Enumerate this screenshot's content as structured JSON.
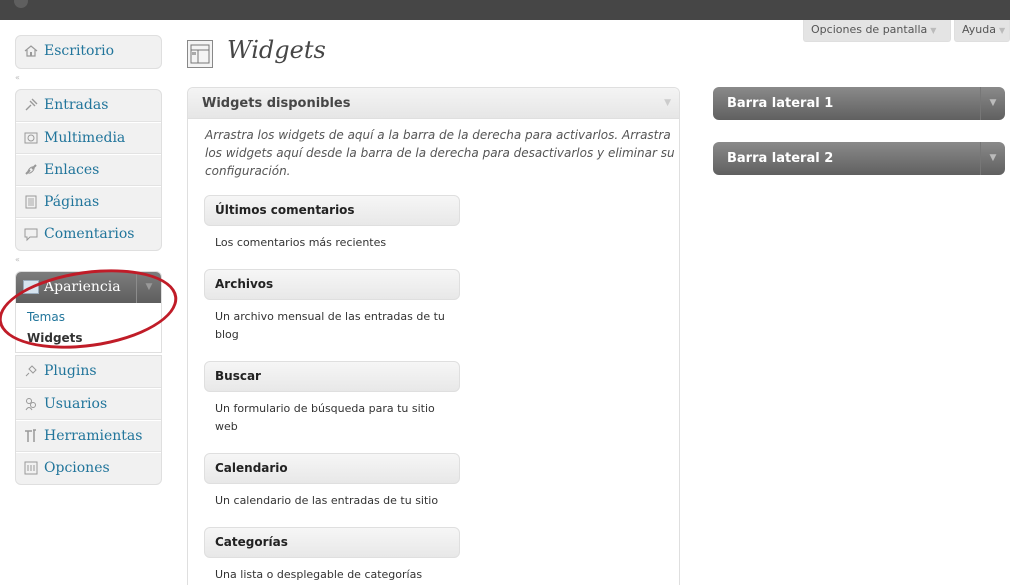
{
  "header": {
    "screen_options_label": "Opciones de pantalla",
    "help_label": "Ayuda"
  },
  "sidebar": {
    "items_top": [
      {
        "label": "Escritorio",
        "icon": "home-icon"
      }
    ],
    "items_content": [
      {
        "label": "Entradas",
        "icon": "pin-icon"
      },
      {
        "label": "Multimedia",
        "icon": "media-icon"
      },
      {
        "label": "Enlaces",
        "icon": "link-icon"
      },
      {
        "label": "Páginas",
        "icon": "page-icon"
      },
      {
        "label": "Comentarios",
        "icon": "comment-icon"
      }
    ],
    "appearance": {
      "label": "Apariencia",
      "icon": "appearance-icon",
      "submenu": [
        "Temas",
        "Widgets"
      ]
    },
    "items_bottom": [
      {
        "label": "Plugins",
        "icon": "plugin-icon"
      },
      {
        "label": "Usuarios",
        "icon": "users-icon"
      },
      {
        "label": "Herramientas",
        "icon": "tools-icon"
      },
      {
        "label": "Opciones",
        "icon": "settings-icon"
      }
    ]
  },
  "page": {
    "title": "Widgets"
  },
  "available": {
    "title": "Widgets disponibles",
    "description": "Arrastra los widgets de aquí a la barra de la derecha para activarlos. Arrastra los widgets aquí desde la barra de la derecha para desactivarlos y eliminar su configuración.",
    "widgets": [
      {
        "title": "Últimos comentarios",
        "desc": "Los comentarios más recientes"
      },
      {
        "title": "Archivos",
        "desc": "Un archivo mensual de las entradas de tu blog"
      },
      {
        "title": "Buscar",
        "desc": "Un formulario de búsqueda para tu sitio web"
      },
      {
        "title": "Calendario",
        "desc": "Un calendario de las entradas de tu sitio"
      },
      {
        "title": "Categorías",
        "desc": "Una lista o desplegable de categorías"
      }
    ]
  },
  "sidebars": [
    {
      "title": "Barra lateral 1"
    },
    {
      "title": "Barra lateral 2"
    }
  ],
  "colors": {
    "link": "#21759b",
    "highlight_oval": "#c01c28",
    "admin_bar": "#464646"
  }
}
